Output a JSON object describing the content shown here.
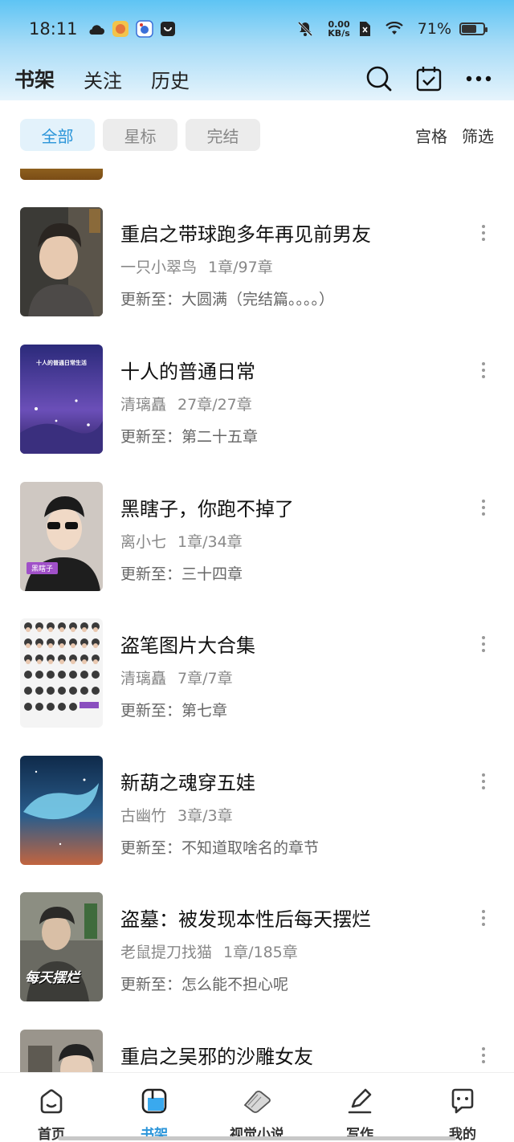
{
  "status_bar": {
    "time": "18:11",
    "net_speed_value": "0.00",
    "net_speed_unit": "KB/s",
    "battery_percent": "71%",
    "battery_level": 0.71
  },
  "header": {
    "tabs": [
      {
        "label": "书架",
        "active": true
      },
      {
        "label": "关注",
        "active": false
      },
      {
        "label": "历史",
        "active": false
      }
    ]
  },
  "filters": {
    "chips": [
      {
        "label": "全部",
        "active": true
      },
      {
        "label": "星标",
        "active": false
      },
      {
        "label": "完结",
        "active": false
      }
    ],
    "grid_label": "宫格",
    "filter_label": "筛选"
  },
  "books": [
    {
      "title": "重启之带球跑多年再见前男友",
      "author": "一只小翠鸟",
      "progress": "1章/97章",
      "update": "更新至：大圆满（完结篇。。。。）",
      "cover_overlay": ""
    },
    {
      "title": "十人的普通日常",
      "author": "清璃矗",
      "progress": "27章/27章",
      "update": "更新至：第二十五章",
      "cover_overlay": "十人的普通日常生活"
    },
    {
      "title": "黑瞎子，你跑不掉了",
      "author": "离小七",
      "progress": "1章/34章",
      "update": "更新至：三十四章",
      "cover_overlay": "黑瞎子"
    },
    {
      "title": "盗笔图片大合集",
      "author": "清璃矗",
      "progress": "7章/7章",
      "update": "更新至：第七章",
      "cover_overlay": ""
    },
    {
      "title": "新葫之魂穿五娃",
      "author": "古幽竹",
      "progress": "3章/3章",
      "update": "更新至：不知道取啥名的章节",
      "cover_overlay": ""
    },
    {
      "title": "盗墓：被发现本性后每天摆烂",
      "author": "老鼠提刀找猫",
      "progress": "1章/185章",
      "update": "更新至：怎么能不担心呢",
      "cover_overlay": "每天摆烂"
    },
    {
      "title": "重启之吴邪的沙雕女友",
      "author": "",
      "progress": "",
      "update": "",
      "cover_overlay": ""
    }
  ],
  "bottom_nav": [
    {
      "label": "首页",
      "icon": "home-icon",
      "active": false
    },
    {
      "label": "书架",
      "icon": "bookshelf-icon",
      "active": true
    },
    {
      "label": "视觉小说",
      "icon": "visual-novel-icon",
      "active": false
    },
    {
      "label": "写作",
      "icon": "write-icon",
      "active": false
    },
    {
      "label": "我的",
      "icon": "profile-icon",
      "active": false
    }
  ],
  "colors": {
    "accent": "#2b95d9",
    "header_gradient_top": "#5ec4f4",
    "chip_active_bg": "#e3f2fb"
  }
}
